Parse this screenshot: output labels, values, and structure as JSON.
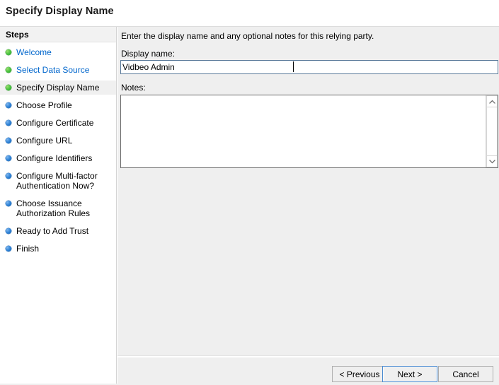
{
  "window": {
    "title": "Specify Display Name"
  },
  "sidebar": {
    "header": "Steps",
    "items": [
      {
        "label": "Welcome",
        "state": "done",
        "link": true,
        "current": false
      },
      {
        "label": "Select Data Source",
        "state": "done",
        "link": true,
        "current": false
      },
      {
        "label": "Specify Display Name",
        "state": "done",
        "link": false,
        "current": true
      },
      {
        "label": "Choose Profile",
        "state": "todo",
        "link": false,
        "current": false
      },
      {
        "label": "Configure Certificate",
        "state": "todo",
        "link": false,
        "current": false
      },
      {
        "label": "Configure URL",
        "state": "todo",
        "link": false,
        "current": false
      },
      {
        "label": "Configure Identifiers",
        "state": "todo",
        "link": false,
        "current": false
      },
      {
        "label": "Configure Multi-factor Authentication Now?",
        "state": "todo",
        "link": false,
        "current": false
      },
      {
        "label": "Choose Issuance Authorization Rules",
        "state": "todo",
        "link": false,
        "current": false
      },
      {
        "label": "Ready to Add Trust",
        "state": "todo",
        "link": false,
        "current": false
      },
      {
        "label": "Finish",
        "state": "todo",
        "link": false,
        "current": false
      }
    ]
  },
  "main": {
    "intro": "Enter the display name and any optional notes for this relying party.",
    "display_name_label": "Display name:",
    "display_name_value": "Vidbeo Admin",
    "display_name_placeholder": "",
    "notes_label": "Notes:",
    "notes_value": "",
    "notes_placeholder": "",
    "scroll_up_icon": "chevron-up-icon",
    "scroll_down_icon": "chevron-down-icon"
  },
  "footer": {
    "previous_label": "< Previous",
    "next_label": "Next >",
    "cancel_label": "Cancel"
  },
  "colors": {
    "step_done": "#44c13c",
    "step_todo": "#2a7fd4",
    "link": "#0066cc",
    "panel_bg": "#efefef",
    "focus_border": "#4b8bd0"
  }
}
